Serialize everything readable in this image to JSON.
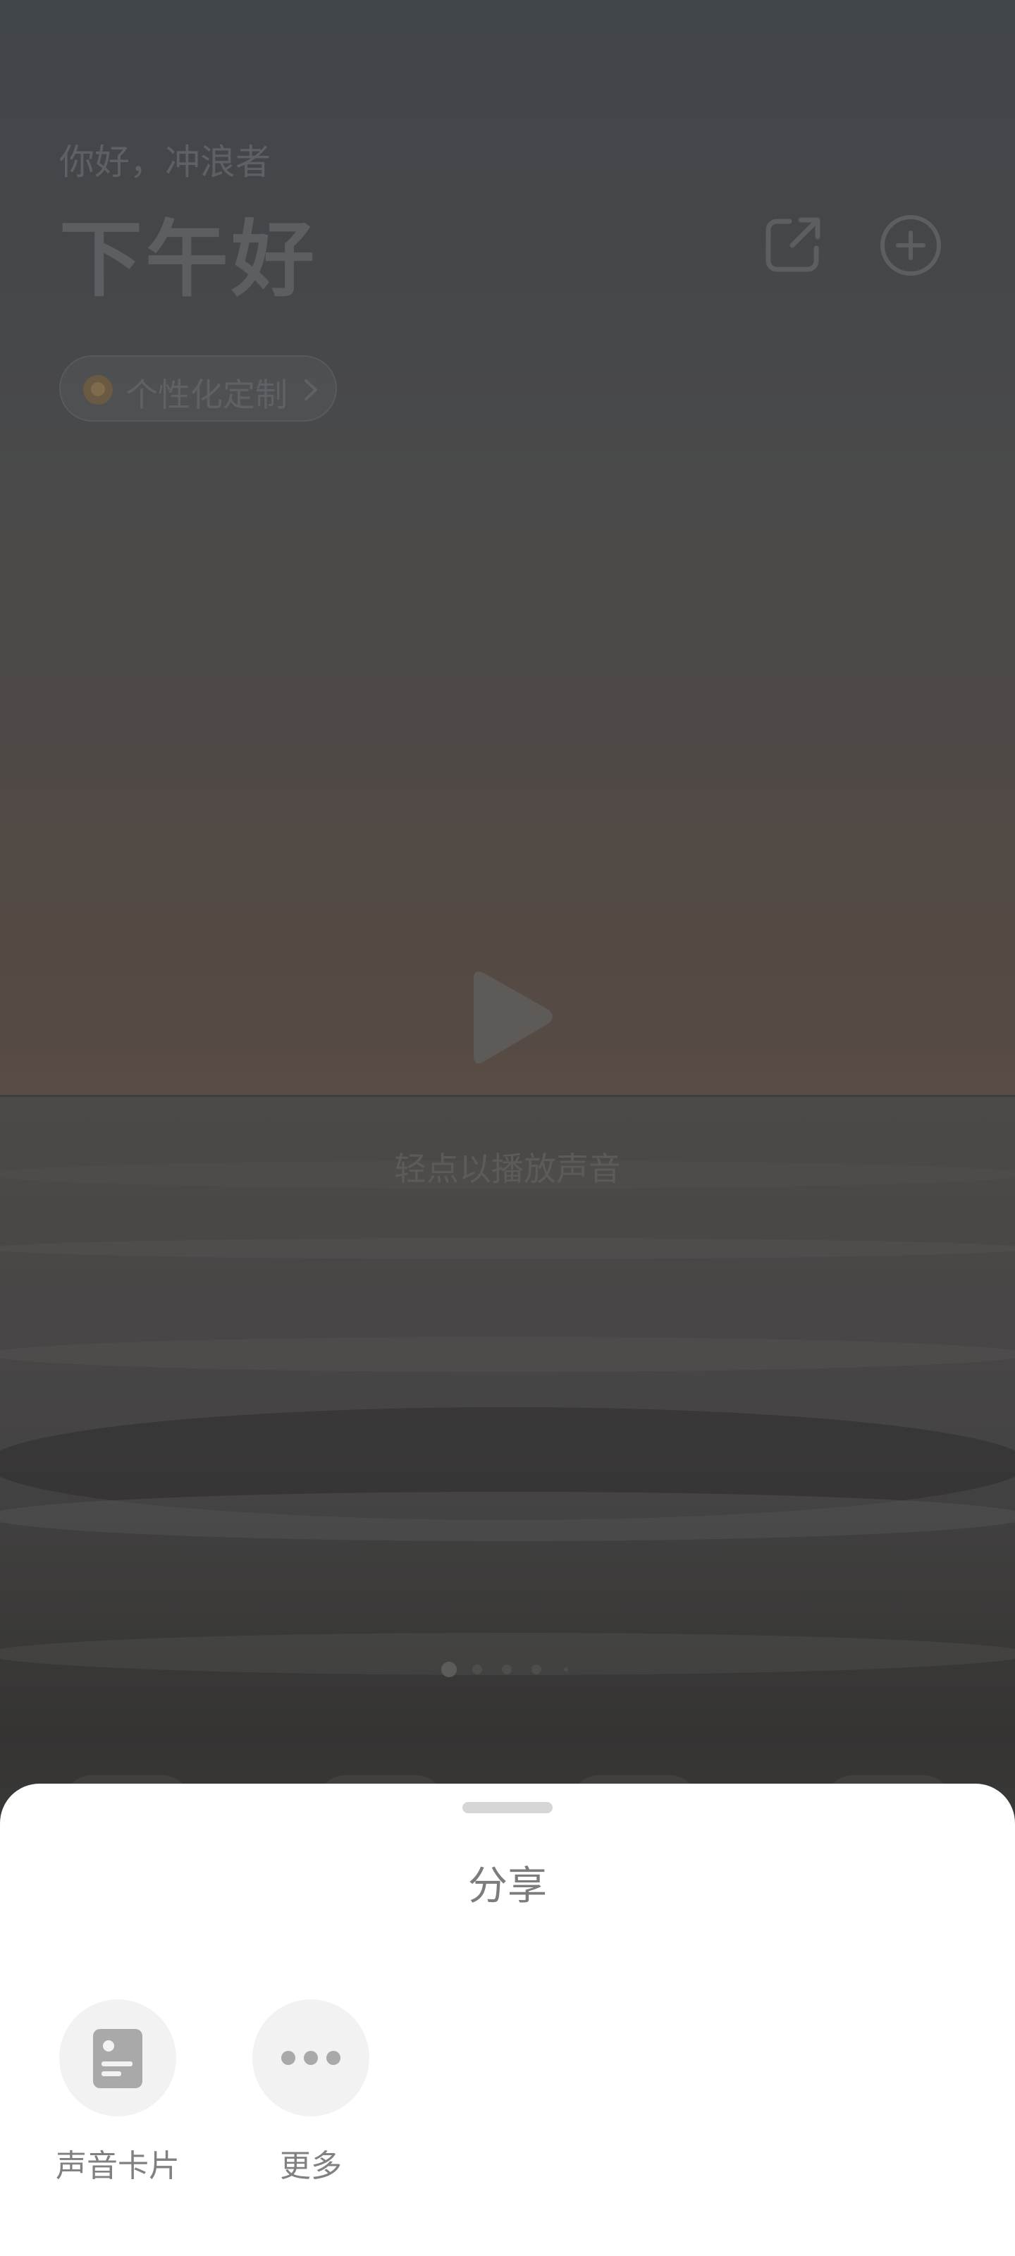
{
  "header": {
    "greeting_small": "你好，冲浪者",
    "greeting_large": "下午好"
  },
  "icons": {
    "share": "share-icon",
    "add": "add-circle-icon",
    "chip_badge": "badge-icon",
    "chevron": "chevron-right-icon",
    "play": "play-icon",
    "card": "sound-card-icon",
    "more": "more-dots-icon"
  },
  "customize_chip": {
    "label": "个性化定制"
  },
  "player": {
    "hint": "轻点以播放声音"
  },
  "pager": {
    "page_count": 5,
    "active_index": 0
  },
  "share_sheet": {
    "title": "分享",
    "options": [
      {
        "label": "声音卡片",
        "icon": "sound-card-icon"
      },
      {
        "label": "更多",
        "icon": "more-dots-icon"
      }
    ]
  },
  "colors": {
    "sheet_bg": "#ffffff",
    "option_circle": "#f2f2f2",
    "dim_text": "#5d6164"
  }
}
